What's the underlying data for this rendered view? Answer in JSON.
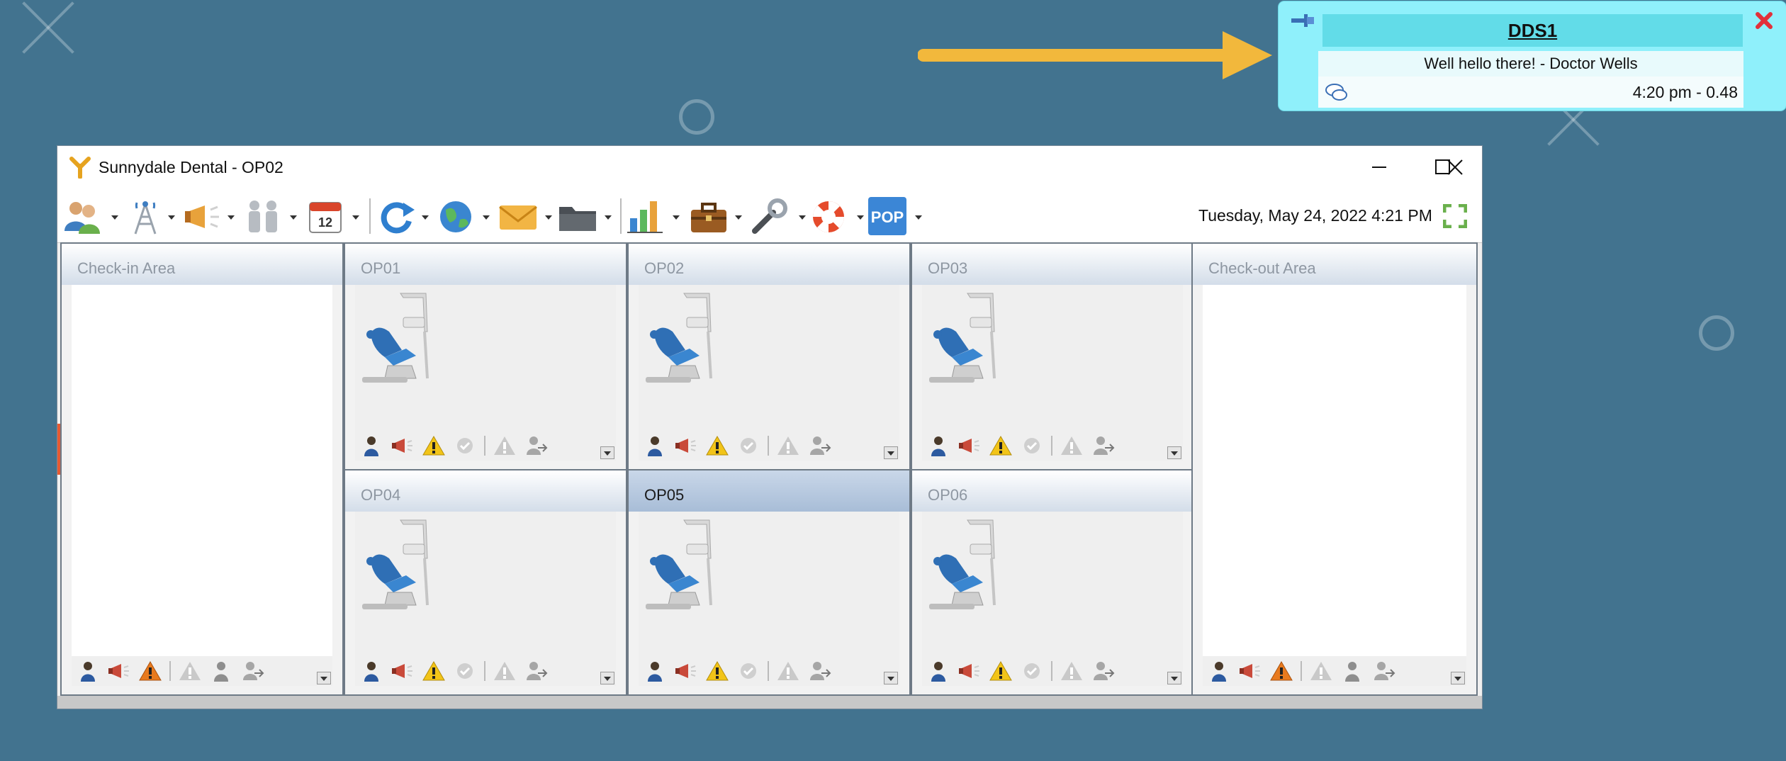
{
  "notification": {
    "title": "DDS1",
    "message": "Well hello there! - Doctor Wells",
    "time": "4:20 pm - 0.48",
    "pin_icon": "pin-icon",
    "close_icon": "close-red-icon",
    "chat_icon": "chat-bubbles-icon"
  },
  "window": {
    "title": "Sunnydale Dental - OP02",
    "minimize_glyph": "minimize-icon",
    "maximize_glyph": "maximize-icon",
    "close_glyph": "close-icon"
  },
  "toolbar": {
    "items": [
      {
        "name": "patients-button",
        "icon": "users-icon"
      },
      {
        "name": "network-button",
        "icon": "antenna-tower-icon"
      },
      {
        "name": "announce-button",
        "icon": "megaphone-icon"
      },
      {
        "name": "staff-button",
        "icon": "people-icon"
      },
      {
        "name": "calendar-button",
        "icon": "calendar-icon",
        "calendar_day": "12"
      },
      {
        "name": "refresh-button",
        "icon": "refresh-icon"
      },
      {
        "name": "web-button",
        "icon": "globe-icon"
      },
      {
        "name": "mail-button",
        "icon": "mail-icon"
      },
      {
        "name": "folder-button",
        "icon": "folder-icon"
      },
      {
        "name": "reports-button",
        "icon": "bar-chart-icon"
      },
      {
        "name": "briefcase-button",
        "icon": "briefcase-icon"
      },
      {
        "name": "tools-button",
        "icon": "wrench-icon"
      },
      {
        "name": "help-button",
        "icon": "lifebuoy-icon"
      },
      {
        "name": "pop-button",
        "icon": "pop-icon",
        "label": "POP"
      }
    ],
    "datetime": "Tuesday, May 24, 2022 4:21 PM"
  },
  "panels": {
    "checkin": {
      "label": "Check-in Area"
    },
    "checkout": {
      "label": "Check-out Area"
    },
    "ops": [
      {
        "label": "OP01"
      },
      {
        "label": "OP02"
      },
      {
        "label": "OP03"
      },
      {
        "label": "OP04"
      },
      {
        "label": "OP05",
        "selected": true
      },
      {
        "label": "OP06"
      }
    ]
  },
  "colors": {
    "desktop": "#42738f",
    "notification_bg": "#8ff0fb",
    "arrow": "#f2b83c",
    "selected_header": "#a8bdd7"
  }
}
